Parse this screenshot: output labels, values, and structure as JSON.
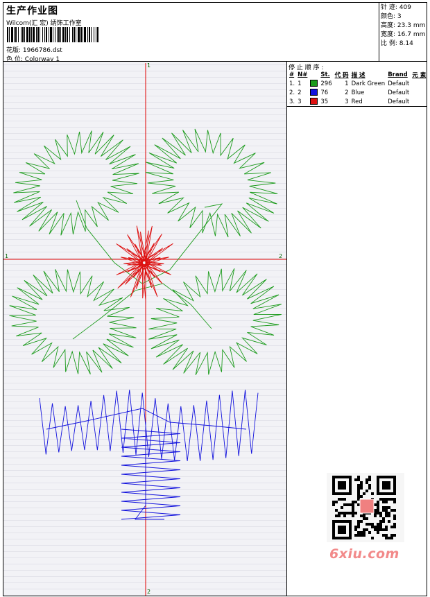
{
  "header": {
    "title": "生产作业图",
    "company": "Wilcom(汇 宏) 绣饰工作室",
    "pattern_label": "花版:",
    "pattern_value": "1966786.dst",
    "colorway_label": "色 位:",
    "colorway_value": "Colorway 1"
  },
  "stats": [
    {
      "label": "针 迹:",
      "value": "409"
    },
    {
      "label": "颜色:",
      "value": "3"
    },
    {
      "label": "高度:",
      "value": "23.3 mm"
    },
    {
      "label": "宽度:",
      "value": "16.7 mm"
    },
    {
      "label": "比 例:",
      "value": "8.14"
    }
  ],
  "panel": {
    "stop_label": "停 止 顺 序 :",
    "columns": [
      "#",
      "N#",
      "St.",
      "代 码",
      "描 述",
      "Brand",
      "元 素"
    ],
    "rows": [
      {
        "index": "1.",
        "n": "1",
        "color": "#1a9a1a",
        "stitches": "296",
        "code": "1",
        "description": "Dark Green",
        "brand": "Default"
      },
      {
        "index": "2.",
        "n": "2",
        "color": "#1111dd",
        "stitches": "76",
        "code": "2",
        "description": "Blue",
        "brand": "Default"
      },
      {
        "index": "3.",
        "n": "3",
        "color": "#dd1111",
        "stitches": "35",
        "code": "3",
        "description": "Red",
        "brand": "Default"
      }
    ]
  },
  "axes": {
    "top_label": "1",
    "bottom_label": "2",
    "left_label": "1",
    "right_label": "2",
    "color": "#e00000"
  },
  "watermark": "6xiu.com",
  "colors": {
    "green": "#1a9a1a",
    "blue": "#1111dd",
    "red": "#dd1111"
  }
}
